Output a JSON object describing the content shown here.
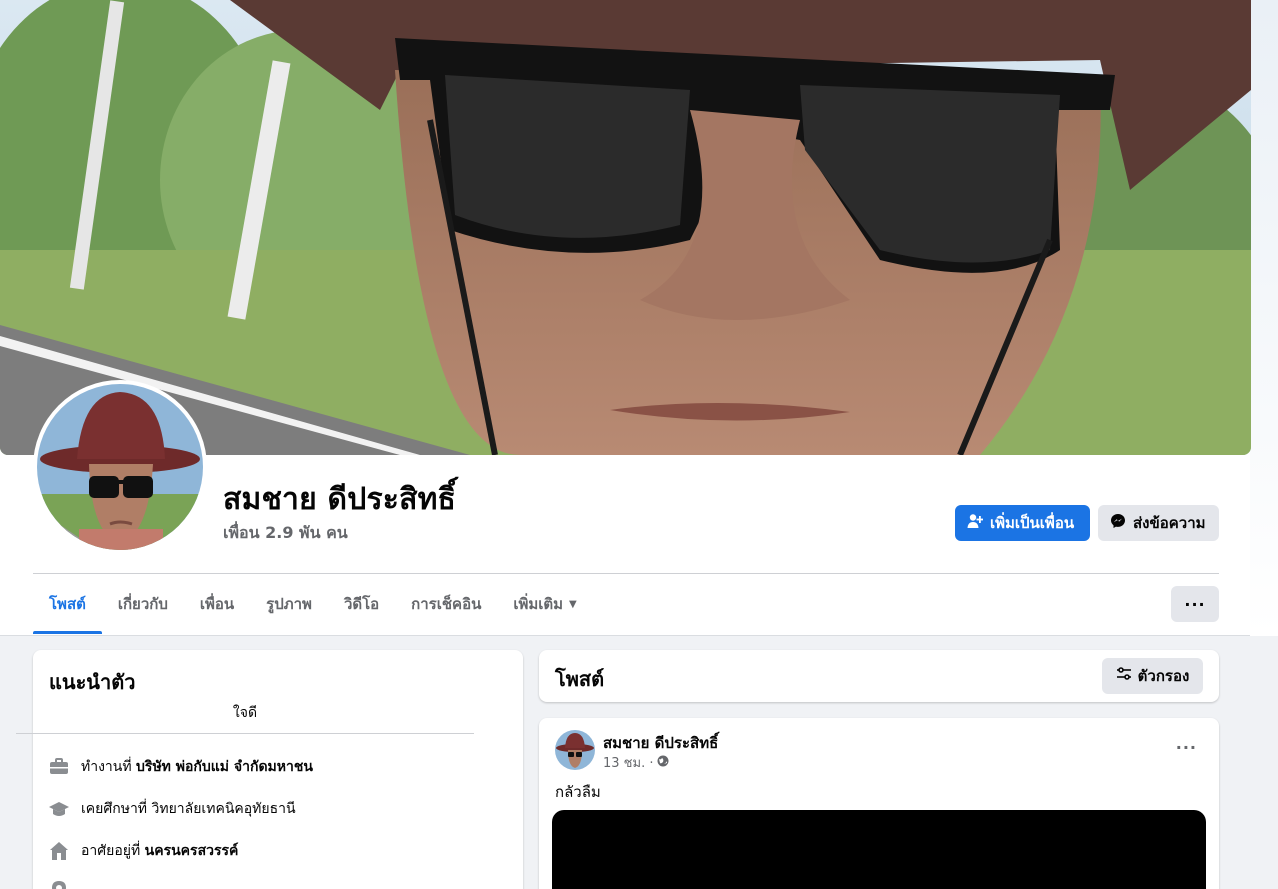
{
  "profile": {
    "name": "สมชาย ดีประสิทธิ์",
    "friends": "เพื่อน 2.9 พัน คน"
  },
  "actions": {
    "add_friend": "เพิ่มเป็นเพื่อน",
    "message": "ส่งข้อความ",
    "more": "···"
  },
  "tabs": [
    {
      "label": "โพสต์",
      "active": true
    },
    {
      "label": "เกี่ยวกับ"
    },
    {
      "label": "เพื่อน"
    },
    {
      "label": "รูปภาพ"
    },
    {
      "label": "วิดีโอ"
    },
    {
      "label": "การเช็คอิน"
    },
    {
      "label": "เพิ่มเติม"
    }
  ],
  "intro": {
    "title": "แนะนำตัว",
    "bio": "ใจดี",
    "work_prefix": "ทำงานที่",
    "work_value": "บริษัท พ่อกับแม่ จำกัดมหาชน",
    "study_prefix": "เคยศึกษาที่",
    "study_value": "วิทยาลัยเทคนิคอุทัยธานี",
    "lives_prefix": "อาศัยอยู่ที่",
    "lives_value": "นครนครสวรรค์",
    "icons": [
      "briefcase-icon",
      "graduation-cap-icon",
      "home-icon",
      "location-pin-icon"
    ]
  },
  "posts": {
    "title": "โพสต์",
    "filter": "ตัวกรอง"
  },
  "post": {
    "author": "สมชาย ดีประสิทธิ์",
    "time": "13 ชม. ·",
    "text": "กลัวลืม",
    "options": "···"
  },
  "colors": {
    "accent": "#1b74e4",
    "background": "#f0f2f5",
    "secondary_button": "#e4e6eb",
    "muted_text": "#65676b"
  }
}
